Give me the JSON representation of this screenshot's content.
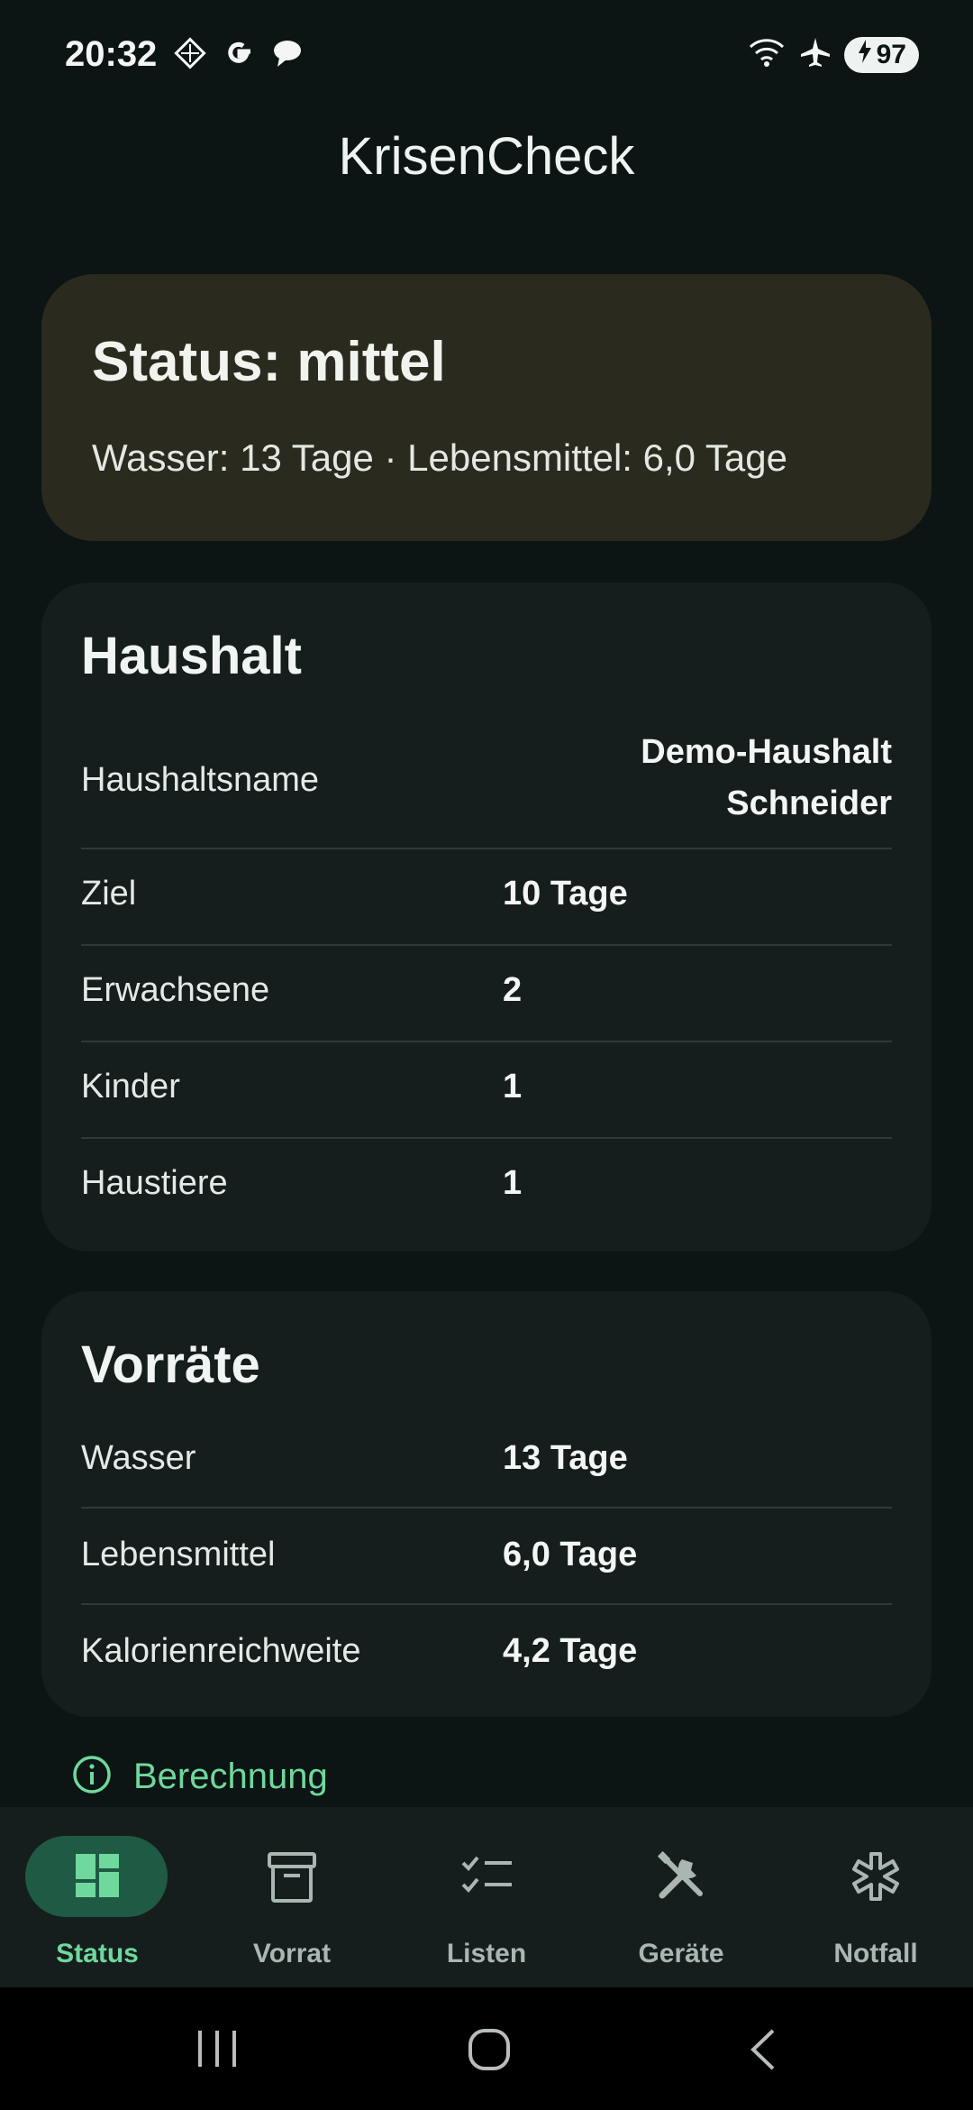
{
  "status_bar": {
    "time": "20:32",
    "left_icons": [
      "diamond-grid-icon",
      "google-icon",
      "chat-bubble-icon"
    ],
    "right_icons": [
      "wifi-icon",
      "airplane-icon"
    ],
    "battery": "97"
  },
  "app_title": "KrisenCheck",
  "status_card": {
    "title": "Status: mittel",
    "subtitle": "Wasser: 13 Tage · Lebensmittel: 6,0 Tage"
  },
  "household": {
    "title": "Haushalt",
    "rows": [
      {
        "label": "Haushaltsname",
        "value": "Demo-Haushalt Schneider"
      },
      {
        "label": "Ziel",
        "value": "10 Tage"
      },
      {
        "label": "Erwachsene",
        "value": "2"
      },
      {
        "label": "Kinder",
        "value": "1"
      },
      {
        "label": "Haustiere",
        "value": "1"
      }
    ]
  },
  "supplies": {
    "title": "Vorräte",
    "rows": [
      {
        "label": "Wasser",
        "value": "13 Tage"
      },
      {
        "label": "Lebensmittel",
        "value": "6,0 Tage"
      },
      {
        "label": "Kalorienreichweite",
        "value": "4,2 Tage"
      }
    ]
  },
  "calculation_link": "Berechnung",
  "bottom_nav": [
    {
      "label": "Status",
      "icon": "dashboard-icon",
      "active": true
    },
    {
      "label": "Vorrat",
      "icon": "archive-box-icon",
      "active": false
    },
    {
      "label": "Listen",
      "icon": "checklist-icon",
      "active": false
    },
    {
      "label": "Geräte",
      "icon": "tools-icon",
      "active": false
    },
    {
      "label": "Notfall",
      "icon": "asterisk-icon",
      "active": false
    }
  ],
  "colors": {
    "background": "#0c1414",
    "card": "#151e1d",
    "status_card": "#2b2a1f",
    "accent": "#6fd89c",
    "active_pill": "#1f5a45"
  }
}
